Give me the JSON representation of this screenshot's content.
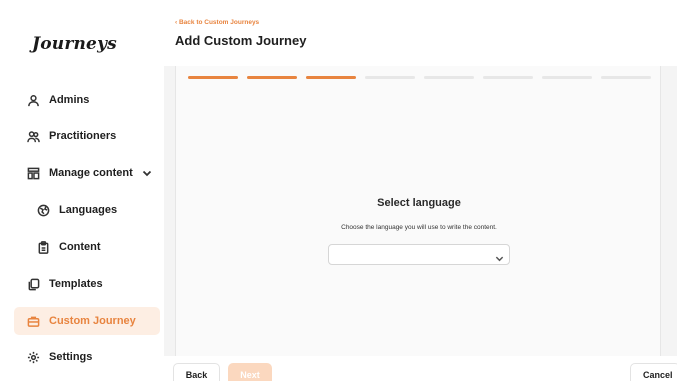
{
  "app": {
    "logo_text": "Journeys"
  },
  "sidebar": {
    "items": [
      {
        "label": "Admins",
        "icon": "user-icon"
      },
      {
        "label": "Practitioners",
        "icon": "users-icon"
      },
      {
        "label": "Manage content",
        "icon": "layout-icon",
        "expanded": true
      },
      {
        "label": "Languages",
        "icon": "globe-icon"
      },
      {
        "label": "Content",
        "icon": "clipboard-icon"
      },
      {
        "label": "Templates",
        "icon": "copy-icon"
      },
      {
        "label": "Custom Journey",
        "icon": "briefcase-icon",
        "active": true
      },
      {
        "label": "Settings",
        "icon": "gear-icon"
      }
    ]
  },
  "header": {
    "back_link": "Back to Custom Journeys",
    "title": "Add Custom Journey"
  },
  "wizard": {
    "total_steps": 8,
    "completed_steps": 3,
    "step_title": "Select language",
    "step_description": "Choose the language you will use to write the content.",
    "language_select_value": ""
  },
  "footer": {
    "back_label": "Back",
    "next_label": "Next",
    "cancel_label": "Cancel"
  },
  "colors": {
    "accent": "#e8843f",
    "active_bg": "#fdeee3",
    "next_disabled": "#fbd8bf"
  }
}
